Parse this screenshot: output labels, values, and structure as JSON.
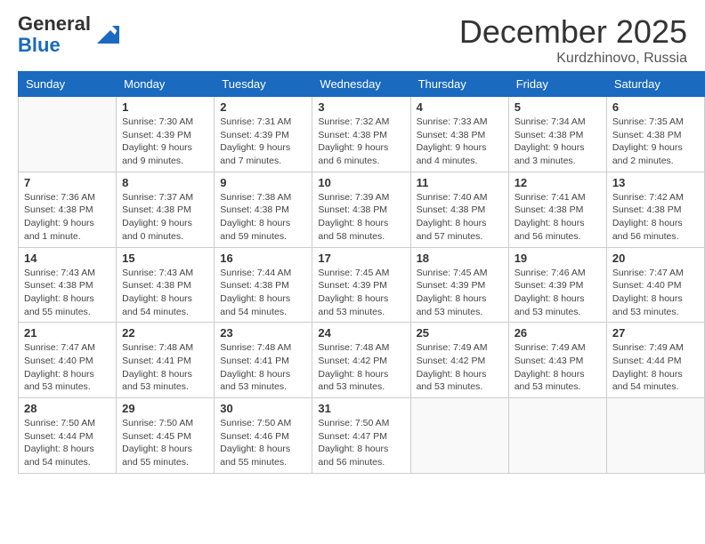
{
  "header": {
    "logo_general": "General",
    "logo_blue": "Blue",
    "month_title": "December 2025",
    "location": "Kurdzhinovo, Russia"
  },
  "days_of_week": [
    "Sunday",
    "Monday",
    "Tuesday",
    "Wednesday",
    "Thursday",
    "Friday",
    "Saturday"
  ],
  "weeks": [
    [
      {
        "day": "",
        "info": ""
      },
      {
        "day": "1",
        "info": "Sunrise: 7:30 AM\nSunset: 4:39 PM\nDaylight: 9 hours\nand 9 minutes."
      },
      {
        "day": "2",
        "info": "Sunrise: 7:31 AM\nSunset: 4:39 PM\nDaylight: 9 hours\nand 7 minutes."
      },
      {
        "day": "3",
        "info": "Sunrise: 7:32 AM\nSunset: 4:38 PM\nDaylight: 9 hours\nand 6 minutes."
      },
      {
        "day": "4",
        "info": "Sunrise: 7:33 AM\nSunset: 4:38 PM\nDaylight: 9 hours\nand 4 minutes."
      },
      {
        "day": "5",
        "info": "Sunrise: 7:34 AM\nSunset: 4:38 PM\nDaylight: 9 hours\nand 3 minutes."
      },
      {
        "day": "6",
        "info": "Sunrise: 7:35 AM\nSunset: 4:38 PM\nDaylight: 9 hours\nand 2 minutes."
      }
    ],
    [
      {
        "day": "7",
        "info": "Sunrise: 7:36 AM\nSunset: 4:38 PM\nDaylight: 9 hours\nand 1 minute."
      },
      {
        "day": "8",
        "info": "Sunrise: 7:37 AM\nSunset: 4:38 PM\nDaylight: 9 hours\nand 0 minutes."
      },
      {
        "day": "9",
        "info": "Sunrise: 7:38 AM\nSunset: 4:38 PM\nDaylight: 8 hours\nand 59 minutes."
      },
      {
        "day": "10",
        "info": "Sunrise: 7:39 AM\nSunset: 4:38 PM\nDaylight: 8 hours\nand 58 minutes."
      },
      {
        "day": "11",
        "info": "Sunrise: 7:40 AM\nSunset: 4:38 PM\nDaylight: 8 hours\nand 57 minutes."
      },
      {
        "day": "12",
        "info": "Sunrise: 7:41 AM\nSunset: 4:38 PM\nDaylight: 8 hours\nand 56 minutes."
      },
      {
        "day": "13",
        "info": "Sunrise: 7:42 AM\nSunset: 4:38 PM\nDaylight: 8 hours\nand 56 minutes."
      }
    ],
    [
      {
        "day": "14",
        "info": "Sunrise: 7:43 AM\nSunset: 4:38 PM\nDaylight: 8 hours\nand 55 minutes."
      },
      {
        "day": "15",
        "info": "Sunrise: 7:43 AM\nSunset: 4:38 PM\nDaylight: 8 hours\nand 54 minutes."
      },
      {
        "day": "16",
        "info": "Sunrise: 7:44 AM\nSunset: 4:38 PM\nDaylight: 8 hours\nand 54 minutes."
      },
      {
        "day": "17",
        "info": "Sunrise: 7:45 AM\nSunset: 4:39 PM\nDaylight: 8 hours\nand 53 minutes."
      },
      {
        "day": "18",
        "info": "Sunrise: 7:45 AM\nSunset: 4:39 PM\nDaylight: 8 hours\nand 53 minutes."
      },
      {
        "day": "19",
        "info": "Sunrise: 7:46 AM\nSunset: 4:39 PM\nDaylight: 8 hours\nand 53 minutes."
      },
      {
        "day": "20",
        "info": "Sunrise: 7:47 AM\nSunset: 4:40 PM\nDaylight: 8 hours\nand 53 minutes."
      }
    ],
    [
      {
        "day": "21",
        "info": "Sunrise: 7:47 AM\nSunset: 4:40 PM\nDaylight: 8 hours\nand 53 minutes."
      },
      {
        "day": "22",
        "info": "Sunrise: 7:48 AM\nSunset: 4:41 PM\nDaylight: 8 hours\nand 53 minutes."
      },
      {
        "day": "23",
        "info": "Sunrise: 7:48 AM\nSunset: 4:41 PM\nDaylight: 8 hours\nand 53 minutes."
      },
      {
        "day": "24",
        "info": "Sunrise: 7:48 AM\nSunset: 4:42 PM\nDaylight: 8 hours\nand 53 minutes."
      },
      {
        "day": "25",
        "info": "Sunrise: 7:49 AM\nSunset: 4:42 PM\nDaylight: 8 hours\nand 53 minutes."
      },
      {
        "day": "26",
        "info": "Sunrise: 7:49 AM\nSunset: 4:43 PM\nDaylight: 8 hours\nand 53 minutes."
      },
      {
        "day": "27",
        "info": "Sunrise: 7:49 AM\nSunset: 4:44 PM\nDaylight: 8 hours\nand 54 minutes."
      }
    ],
    [
      {
        "day": "28",
        "info": "Sunrise: 7:50 AM\nSunset: 4:44 PM\nDaylight: 8 hours\nand 54 minutes."
      },
      {
        "day": "29",
        "info": "Sunrise: 7:50 AM\nSunset: 4:45 PM\nDaylight: 8 hours\nand 55 minutes."
      },
      {
        "day": "30",
        "info": "Sunrise: 7:50 AM\nSunset: 4:46 PM\nDaylight: 8 hours\nand 55 minutes."
      },
      {
        "day": "31",
        "info": "Sunrise: 7:50 AM\nSunset: 4:47 PM\nDaylight: 8 hours\nand 56 minutes."
      },
      {
        "day": "",
        "info": ""
      },
      {
        "day": "",
        "info": ""
      },
      {
        "day": "",
        "info": ""
      }
    ]
  ]
}
